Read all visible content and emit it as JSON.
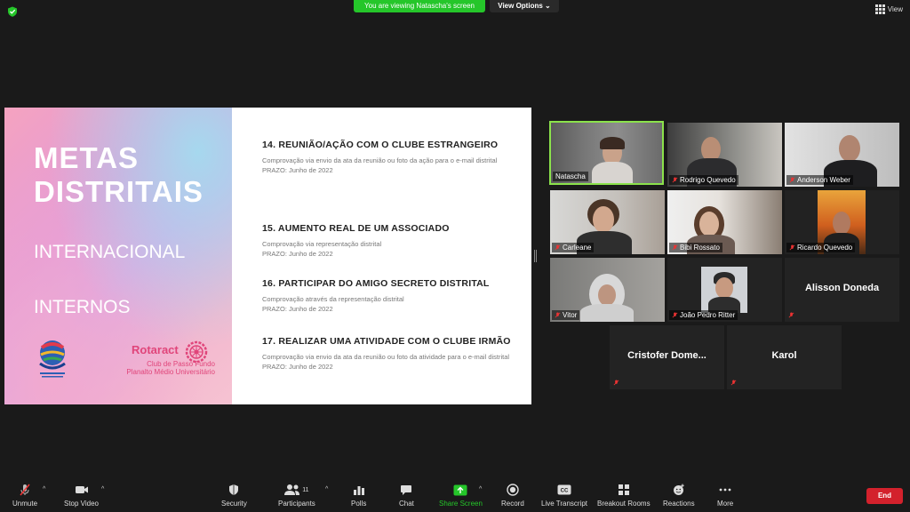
{
  "top": {
    "viewing_banner": "You are viewing Natascha's screen",
    "view_options": "View Options",
    "view_button": "View"
  },
  "slide": {
    "title_line1": "METAS",
    "title_line2": "DISTRITAIS",
    "section1": "INTERNACIONAL",
    "section2": "INTERNOS",
    "rotaract": "Rotaract",
    "club_line1": "Club de Passo Fundo",
    "club_line2": "Planalto Médio Universitário",
    "goals": [
      {
        "title": "14. REUNIÃO/AÇÃO COM O CLUBE ESTRANGEIRO",
        "desc": "Comprovação via envio da ata da reunião ou foto da ação para o e-mail distrital",
        "prazo": "PRAZO: Junho de 2022"
      },
      {
        "title": "15. AUMENTO REAL DE UM ASSOCIADO",
        "desc": "Comprovação via representação distrital",
        "prazo": "PRAZO: Junho de 2022"
      },
      {
        "title": "16. PARTICIPAR DO AMIGO SECRETO DISTRITAL",
        "desc": "Comprovação através da representação distrital",
        "prazo": "PRAZO: Junho de 2022"
      },
      {
        "title": "17. REALIZAR UMA ATIVIDADE COM O CLUBE IRMÃO",
        "desc": "Comprovação via envio da ata da reunião ou foto da atividade para o e-mail distrital",
        "prazo": "PRAZO: Junho de 2022"
      }
    ]
  },
  "participants": [
    {
      "name": "Natascha"
    },
    {
      "name": "Rodrigo Quevedo"
    },
    {
      "name": "Anderson Weber"
    },
    {
      "name": "Carleane"
    },
    {
      "name": "Bibi Rossato"
    },
    {
      "name": "Ricardo Quevedo"
    },
    {
      "name": "Vitor"
    },
    {
      "name": "João Pedro Ritter"
    },
    {
      "name": "Alisson Doneda"
    },
    {
      "name": "Cristofer  Dome..."
    },
    {
      "name": "Karol"
    }
  ],
  "toolbar": {
    "unmute": "Unmute",
    "stop_video": "Stop Video",
    "security": "Security",
    "participants": "Participants",
    "participants_count": "11",
    "polls": "Polls",
    "chat": "Chat",
    "share_screen": "Share Screen",
    "record": "Record",
    "live_transcript": "Live Transcript",
    "breakout_rooms": "Breakout Rooms",
    "reactions": "Reactions",
    "more": "More",
    "end": "End"
  },
  "colors": {
    "accent_green": "#25c62a",
    "end_red": "#d3212c",
    "active_speaker": "#8be24b",
    "rotaract_pink": "#e0457a"
  }
}
